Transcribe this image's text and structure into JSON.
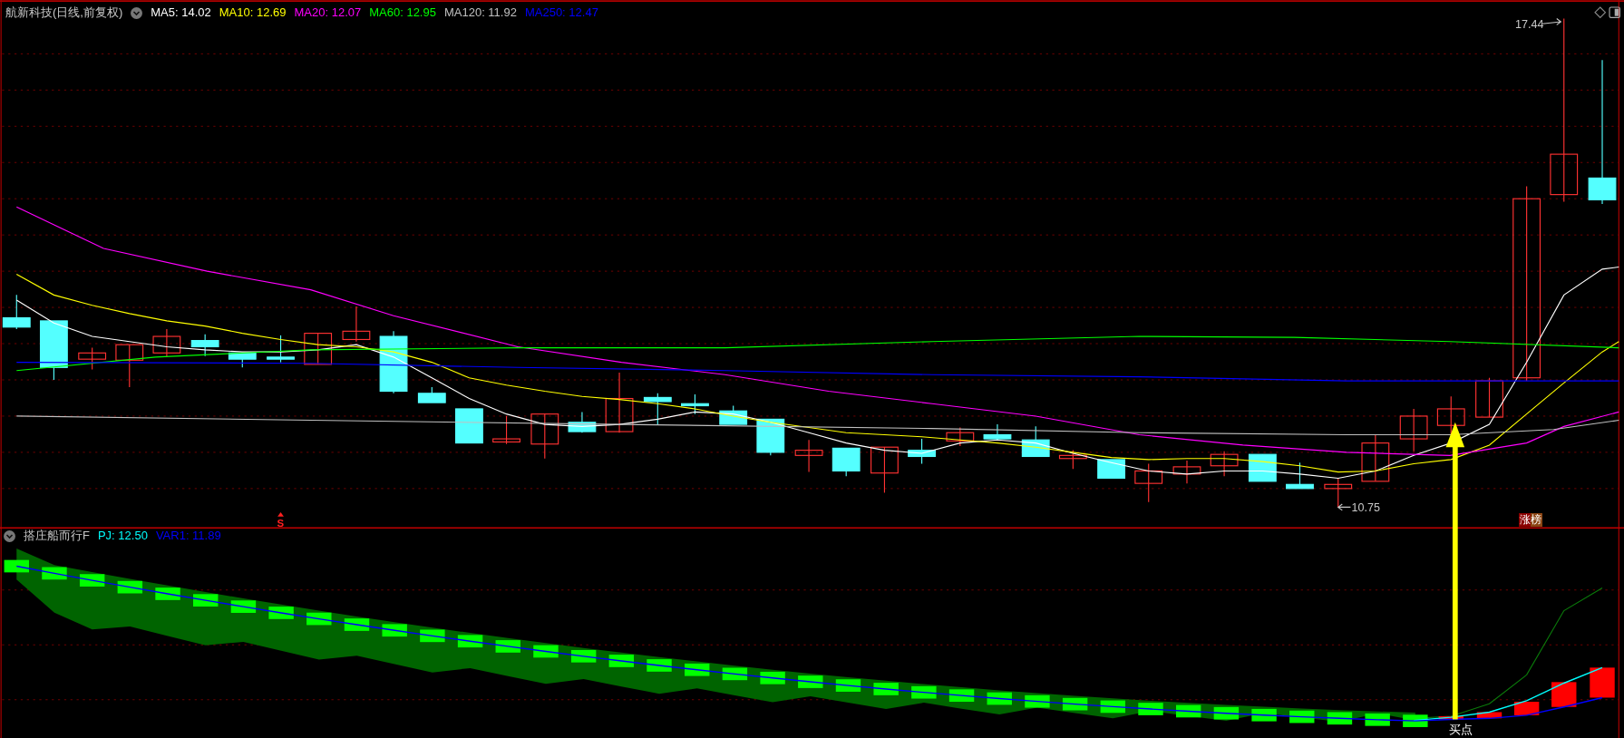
{
  "main_panel": {
    "title": "航新科技(日线,前复权)",
    "indicators": [
      {
        "label": "MA5: 14.02",
        "color": "#ffffff"
      },
      {
        "label": "MA10: 12.69",
        "color": "#ffff00"
      },
      {
        "label": "MA20: 12.07",
        "color": "#ff00ff"
      },
      {
        "label": "MA60: 12.95",
        "color": "#00ff00"
      },
      {
        "label": "MA120: 11.92",
        "color": "#c0c0c0"
      },
      {
        "label": "MA250: 12.47",
        "color": "#0000ff"
      }
    ],
    "high_label": "17.44",
    "low_label": "10.75",
    "signal_mark": "S",
    "badge": "涨榜"
  },
  "sub_panel": {
    "title": "搭庄船而行F",
    "indicators": [
      {
        "label": "PJ: 12.50",
        "color": "#00ffff"
      },
      {
        "label": "VAR1: 11.89",
        "color": "#0000ff"
      }
    ],
    "buy_label": "买点"
  }
}
